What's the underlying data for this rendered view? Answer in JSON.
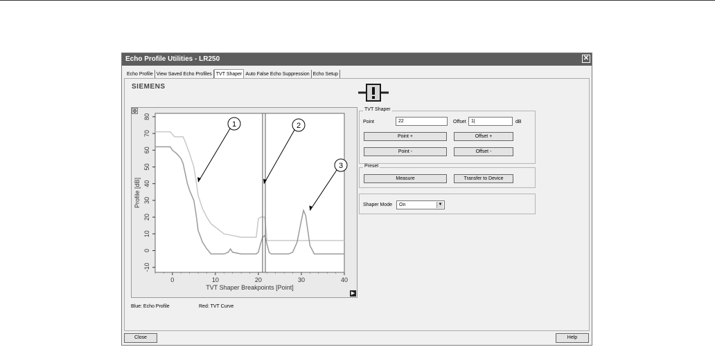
{
  "window": {
    "title": "Echo Profile Utilities - LR250",
    "close_glyph": "✕"
  },
  "tabs": [
    {
      "label": "Echo Profile"
    },
    {
      "label": "View Saved Echo Profiles"
    },
    {
      "label": "TVT Shaper",
      "active": true
    },
    {
      "label": "Auto False Echo Suppression"
    },
    {
      "label": "Echo Setup"
    }
  ],
  "brand": "SIEMENS",
  "status_icon": "warning-icon",
  "chart_data": {
    "type": "line",
    "xlabel": "TVT Shaper Breakpoints [Point]",
    "ylabel": "Profile [dB]",
    "xlim": [
      -4,
      40
    ],
    "ylim": [
      -13,
      82
    ],
    "x_ticks": [
      0,
      10,
      20,
      30,
      40
    ],
    "y_ticks": [
      -10,
      0,
      10,
      20,
      30,
      40,
      50,
      60,
      70,
      80
    ],
    "grid": false,
    "cursor_x": 21.3,
    "series": [
      {
        "name": "TVT Curve",
        "color": "#c8c8c8",
        "x": [
          -4,
          -0.5,
          0.5,
          2.5,
          3,
          4,
          5,
          5.5,
          6,
          7,
          8,
          9,
          10,
          12,
          14,
          16,
          18,
          19.5,
          20,
          20.5,
          21.5,
          22,
          30,
          40
        ],
        "y": [
          71,
          71,
          68,
          68,
          65,
          58,
          50,
          42,
          33,
          25,
          20,
          16,
          14,
          10,
          9,
          8,
          8,
          8,
          19,
          20,
          20,
          6,
          6,
          6
        ]
      },
      {
        "name": "Echo Profile",
        "color": "#9a9a9a",
        "x": [
          -4,
          -0.5,
          0,
          1,
          2,
          2.5,
          3,
          3.5,
          4,
          5,
          5.5,
          6,
          7,
          8,
          9,
          10,
          11,
          12,
          13,
          13.5,
          14,
          16,
          18,
          19.5,
          20,
          20.5,
          21,
          21.5,
          22,
          22.5,
          23,
          24,
          25,
          27,
          28,
          29,
          30,
          30.5,
          31,
          31.5,
          32,
          33,
          34,
          36,
          38,
          40
        ],
        "y": [
          62,
          62,
          60,
          58,
          55,
          52,
          46,
          40,
          36,
          30,
          22,
          12,
          5,
          1,
          -2,
          -2,
          -2,
          -2,
          -1,
          1,
          -1,
          -2,
          -2,
          -2,
          -1,
          4,
          8,
          9,
          4,
          -1,
          -2,
          -2,
          -2,
          -2,
          -1,
          5,
          18,
          24,
          21,
          12,
          3,
          -2,
          -2,
          -2,
          -2,
          -2
        ]
      }
    ],
    "callouts": [
      {
        "label": "1",
        "x": 6,
        "y": 41
      },
      {
        "label": "2",
        "x": 21.3,
        "y": 40
      },
      {
        "label": "3",
        "x": 32,
        "y": 24
      }
    ]
  },
  "legend": {
    "echo": "Blue: Echo Profile",
    "tvt": "Red: TVT Curve"
  },
  "tvt_shaper": {
    "title": "TVT Shaper",
    "point_label": "Point",
    "point_value": "22",
    "offset_label": "Offset",
    "offset_value": "1|",
    "offset_unit": "dB",
    "point_plus": "Point +",
    "offset_plus": "Offset +",
    "point_minus": "Point -",
    "offset_minus": "Offset -"
  },
  "preset": {
    "title": "Preset",
    "measure": "Measure",
    "transfer": "Transfer to Device"
  },
  "shaper_mode": {
    "label": "Shaper Mode",
    "value": "On"
  },
  "footer": {
    "close": "Close",
    "help": "Help"
  },
  "colors": {
    "titlebar": "#5d5d5d",
    "plot_bg": "#ffffff",
    "cursor": "#555555"
  }
}
